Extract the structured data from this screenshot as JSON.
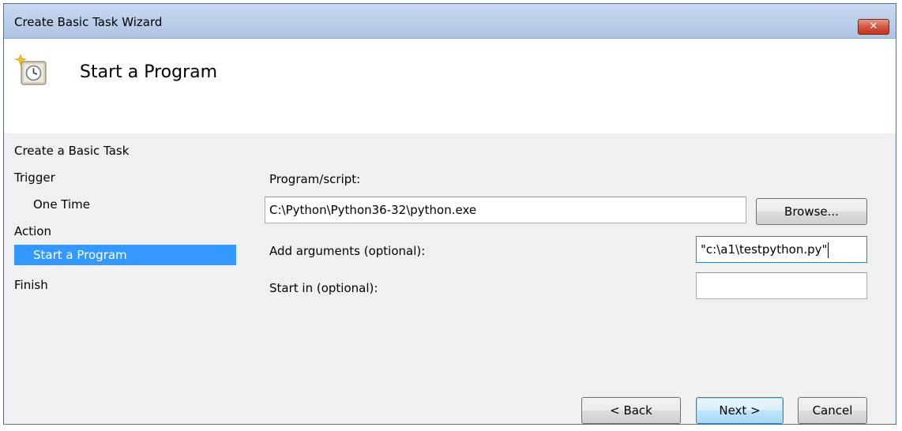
{
  "window": {
    "title": "Create Basic Task Wizard",
    "close_glyph": "✕"
  },
  "header": {
    "title": "Start a Program",
    "icon": "scheduled-task-clock-icon"
  },
  "nav": {
    "items": [
      {
        "label": "Create a Basic Task",
        "level": 0,
        "selected": false
      },
      {
        "label": "Trigger",
        "level": 0,
        "selected": false
      },
      {
        "label": "One Time",
        "level": 1,
        "selected": false
      },
      {
        "label": "Action",
        "level": 0,
        "selected": false
      },
      {
        "label": "Start a Program",
        "level": 1,
        "selected": true
      },
      {
        "label": "Finish",
        "level": 0,
        "selected": false
      }
    ]
  },
  "form": {
    "program_label": "Program/script:",
    "program_value": "C:\\Python\\Python36-32\\python.exe",
    "browse_label": "Browse...",
    "arguments_label": "Add arguments (optional):",
    "arguments_value": "\"c:\\a1\\testpython.py\"",
    "start_in_label": "Start in (optional):",
    "start_in_value": ""
  },
  "buttons": {
    "back": "< Back",
    "next": "Next >",
    "cancel": "Cancel"
  },
  "colors": {
    "selection": "#3399ff",
    "titlebar": "#bcd0ea",
    "close": "#d5543c"
  }
}
